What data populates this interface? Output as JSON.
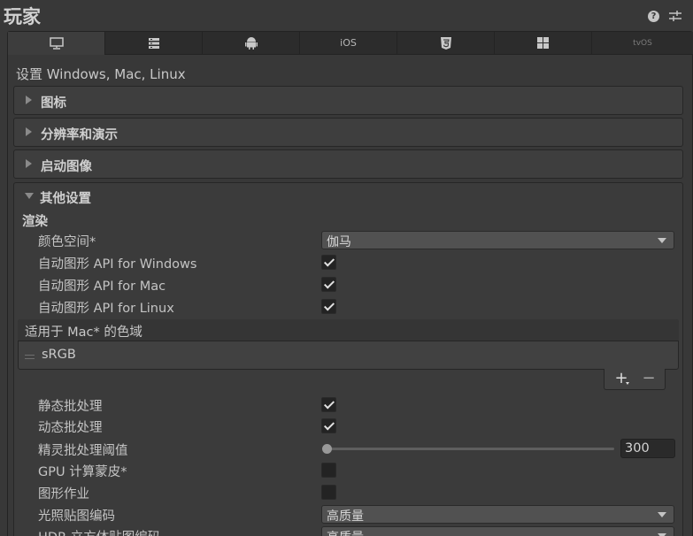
{
  "title": "玩家",
  "tabs": [
    {
      "name": "standalone",
      "label": ""
    },
    {
      "name": "server",
      "label": ""
    },
    {
      "name": "android",
      "label": ""
    },
    {
      "name": "ios",
      "label": "iOS"
    },
    {
      "name": "webgl",
      "label": ""
    },
    {
      "name": "windows-store",
      "label": ""
    },
    {
      "name": "tvos",
      "label": "tvOS"
    }
  ],
  "subtitle": "设置 Windows, Mac, Linux",
  "sections": {
    "icon": "图标",
    "resolution": "分辨率和演示",
    "splash": "启动图像",
    "other": "其他设置"
  },
  "rendering": {
    "group_label": "渲染",
    "color_space_label": "颜色空间*",
    "color_space_value": "伽马",
    "auto_api_windows": "自动图形 API   for Windows",
    "auto_api_mac": "自动图形 API   for Mac",
    "auto_api_linux": "自动图形 API   for Linux",
    "gamut_header": "适用于 Mac* 的色域",
    "gamut_item": "sRGB",
    "static_batching": "静态批处理",
    "dynamic_batching": "动态批处理",
    "sprite_threshold_label": "精灵批处理阈值",
    "sprite_threshold_value": "300",
    "gpu_skinning": "GPU 计算蒙皮*",
    "graphics_jobs": "图形作业",
    "lightmap_label": "光照贴图编码",
    "lightmap_value": "高质量",
    "hdr_cubemap_label": "HDR 立方体贴图编码",
    "hdr_cubemap_value": "高质量"
  },
  "checks": {
    "auto_api_windows": true,
    "auto_api_mac": true,
    "auto_api_linux": true,
    "static_batching": true,
    "dynamic_batching": true,
    "gpu_skinning": false,
    "graphics_jobs": false
  },
  "sprite_threshold_fraction": 0.0,
  "icons": {
    "help": "help-icon",
    "settings": "settings-sliders-icon",
    "add": "plus-icon",
    "remove": "minus-icon"
  }
}
